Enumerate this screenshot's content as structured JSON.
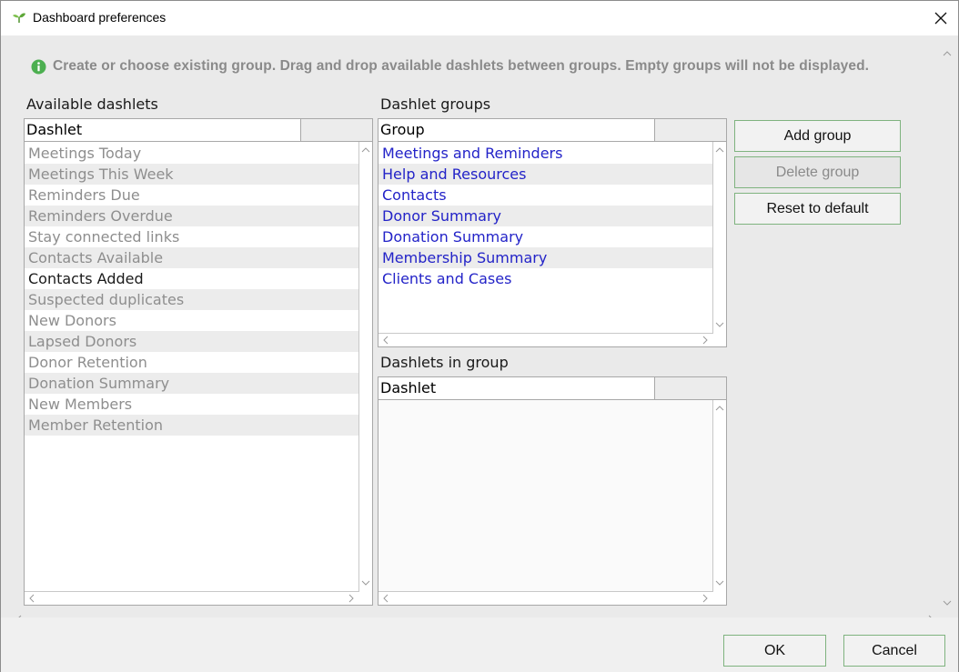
{
  "window": {
    "title": "Dashboard preferences"
  },
  "info": {
    "text": "Create or choose existing group. Drag and drop available dashlets between groups. Empty groups will not be displayed."
  },
  "available": {
    "label": "Available dashlets",
    "column_header": "Dashlet",
    "items": [
      {
        "label": "Meetings Today",
        "state": "gray"
      },
      {
        "label": "Meetings This Week",
        "state": "gray"
      },
      {
        "label": "Reminders Due",
        "state": "gray"
      },
      {
        "label": "Reminders Overdue",
        "state": "gray"
      },
      {
        "label": "Stay connected links",
        "state": "gray"
      },
      {
        "label": "Contacts Available",
        "state": "gray"
      },
      {
        "label": "Contacts Added",
        "state": "dark"
      },
      {
        "label": "Suspected duplicates",
        "state": "gray"
      },
      {
        "label": "New Donors",
        "state": "gray"
      },
      {
        "label": "Lapsed Donors",
        "state": "gray"
      },
      {
        "label": "Donor Retention",
        "state": "gray"
      },
      {
        "label": "Donation Summary",
        "state": "gray"
      },
      {
        "label": "New Members",
        "state": "gray"
      },
      {
        "label": "Member Retention",
        "state": "gray"
      }
    ]
  },
  "groups": {
    "label": "Dashlet groups",
    "column_header": "Group",
    "items": [
      "Meetings and Reminders",
      "Help and Resources",
      "Contacts",
      "Donor Summary",
      "Donation Summary",
      "Membership Summary",
      "Clients and Cases"
    ]
  },
  "in_group": {
    "label": "Dashlets in group",
    "column_header": "Dashlet",
    "items": []
  },
  "buttons": {
    "add_group": "Add group",
    "delete_group": "Delete group",
    "reset_default": "Reset to default",
    "ok": "OK",
    "cancel": "Cancel"
  },
  "colors": {
    "available_text": "#8e8e8e",
    "group_link": "#2323c8",
    "button_border": "#7fb37f",
    "info_icon": "#4caf50"
  },
  "icons": {
    "app": "sprout-icon",
    "close": "close-icon",
    "info": "info-icon"
  }
}
